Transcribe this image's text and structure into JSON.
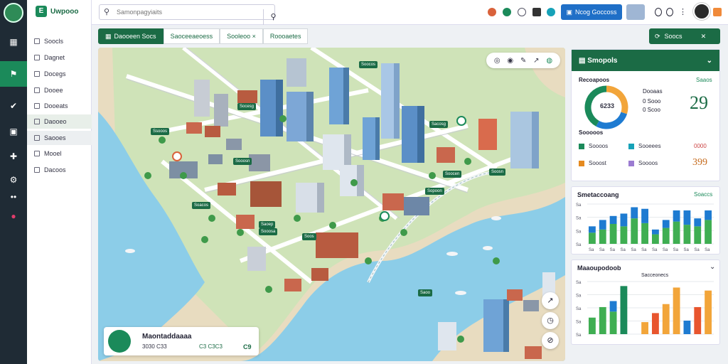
{
  "app": {
    "brand": "Uwpooo"
  },
  "search": {
    "placeholder": "Samonpagyiaits"
  },
  "topbar": {
    "cta_label": "Ncog Goccoss"
  },
  "sidebar": {
    "items": [
      {
        "label": "Soocls"
      },
      {
        "label": "Dagnet"
      },
      {
        "label": "Docegs"
      },
      {
        "label": "Dooee"
      },
      {
        "label": "Dooeats"
      },
      {
        "label": "Daooeo"
      },
      {
        "label": "Saooes"
      },
      {
        "label": "Mooel"
      },
      {
        "label": "Dacoos"
      }
    ]
  },
  "tabs": [
    {
      "label": "Daooeen Socs"
    },
    {
      "label": "Saoceeaeoess"
    },
    {
      "label": "Sooleoo ×"
    },
    {
      "label": "Roooaetes"
    }
  ],
  "share_button": {
    "label": "Soocs"
  },
  "map": {
    "labels": [
      "Ssooos",
      "Socesg",
      "Soocos",
      "Sacosg",
      "Sooosn",
      "Soocen",
      "Soosn",
      "Soacos",
      "Sopoon",
      "Saoep",
      "Soos",
      "Sooosa",
      "Saoo"
    ],
    "info_card": {
      "title": "Maontaddaaaa",
      "subtitle": "3030 C33",
      "value1": "C3 C3C3",
      "value2": "C9"
    }
  },
  "stats_panel": {
    "title": "Smopols",
    "rows": [
      {
        "label": "Recoapoos",
        "value": "Saaos"
      },
      {
        "label": "Dooaas",
        "value": ""
      },
      {
        "label": "0 Sooo",
        "value": "29"
      },
      {
        "label": "0 Scoo",
        "value": ""
      },
      {
        "label": "Sooooos",
        "value": ""
      }
    ],
    "donut_center": "6233",
    "legend": [
      {
        "label": "Soooos",
        "value": "Sooeees",
        "num": "0000",
        "color": "#1b8a5a"
      },
      {
        "label": "Sooost",
        "value": "Soooos",
        "num": "399",
        "color": "#e58a1f"
      }
    ],
    "donut": [
      {
        "label": "Soooos",
        "value": 30,
        "color": "#f2a53a"
      },
      {
        "label": "Soooos",
        "value": 28,
        "color": "#1e7bd1"
      },
      {
        "label": "Soooos",
        "value": 42,
        "color": "#1b8a5a"
      }
    ]
  },
  "chart1": {
    "title": "Smetaccoang",
    "badge": "Soaccs",
    "yticks": [
      "Sa",
      "Sa",
      "Sa",
      "Sa"
    ],
    "xticks": [
      "Sa",
      "Sa",
      "Sa",
      "Sa",
      "Sa",
      "Sa",
      "Sa",
      "Sa",
      "Sa",
      "Sa",
      "Sa",
      "Sa"
    ]
  },
  "chart2": {
    "title": "Maaoupodoob",
    "subtitle": "Sacceonecs",
    "yticks": [
      "Sa",
      "Sa",
      "Sa",
      "Sa",
      "Sa"
    ]
  },
  "chart_data": [
    {
      "type": "bar",
      "title": "Smetaccoang",
      "series": [
        {
          "name": "",
          "values": [
            14,
            18,
            25,
            22,
            32,
            26,
            12,
            20,
            28,
            24,
            22,
            30
          ]
        },
        {
          "name": "",
          "values": [
            8,
            12,
            10,
            16,
            14,
            18,
            6,
            10,
            14,
            18,
            10,
            12
          ]
        }
      ]
    },
    {
      "type": "bar",
      "title": "Maaoupodoob",
      "series": [
        {
          "name": "",
          "values": [
            22,
            36,
            30,
            64,
            0,
            16,
            28,
            40,
            62,
            0,
            36,
            58
          ]
        },
        {
          "name": "",
          "values": [
            0,
            0,
            14,
            0,
            0,
            0,
            0,
            0,
            0,
            18,
            0,
            0
          ]
        }
      ]
    }
  ],
  "colors": {
    "primary": "#1b6b45",
    "accent": "#1b8a5a",
    "blue": "#1e7bd1",
    "orange": "#f2a53a"
  }
}
